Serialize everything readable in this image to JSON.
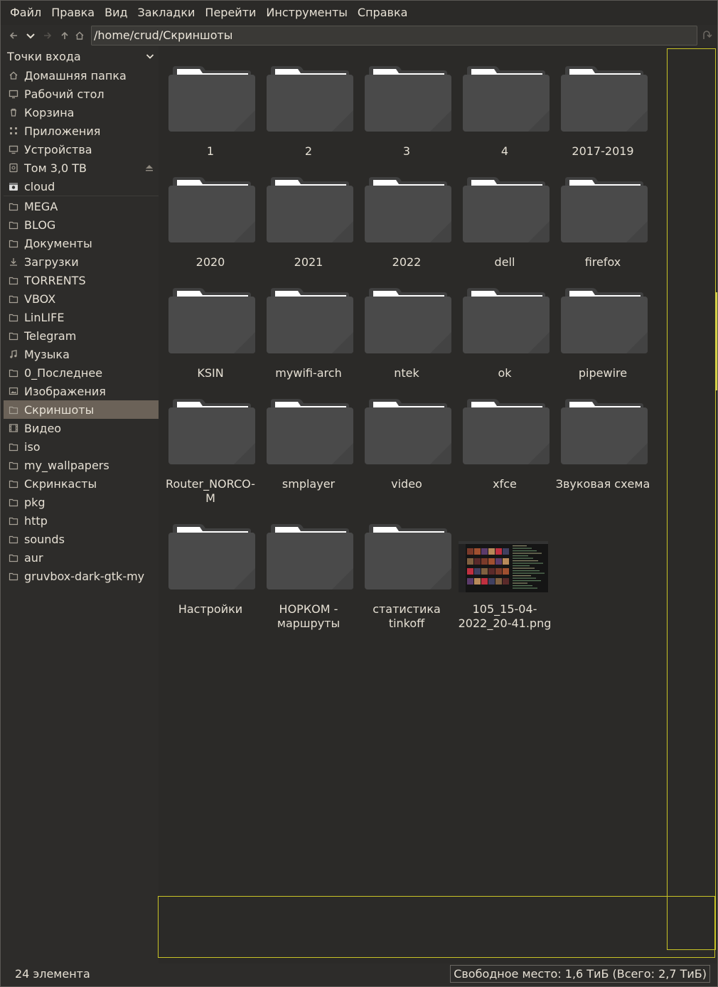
{
  "menu": [
    "Файл",
    "Правка",
    "Вид",
    "Закладки",
    "Перейти",
    "Инструменты",
    "Справка"
  ],
  "toolbar": {
    "path": "/home/crud/Скриншоты",
    "icons": [
      "back-icon",
      "dropdown-icon",
      "forward-icon",
      "up-icon",
      "home-icon",
      "reload-icon"
    ]
  },
  "sidebar": {
    "header": "Точки входа",
    "places": [
      {
        "label": "Домашняя папка",
        "icon": "home-icon"
      },
      {
        "label": "Рабочий стол",
        "icon": "desktop-icon"
      },
      {
        "label": "Корзина",
        "icon": "trash-icon"
      },
      {
        "label": "Приложения",
        "icon": "apps-icon"
      },
      {
        "label": "Устройства",
        "icon": "computer-icon"
      },
      {
        "label": "Том 3,0 ТВ",
        "icon": "drive-icon"
      },
      {
        "label": "cloud",
        "icon": "cloud-drive-icon"
      }
    ],
    "bookmarks": [
      {
        "label": "MEGA",
        "icon": "folder-icon"
      },
      {
        "label": "BLOG",
        "icon": "folder-icon"
      },
      {
        "label": "Документы",
        "icon": "folder-icon"
      },
      {
        "label": "Загрузки",
        "icon": "download-icon"
      },
      {
        "label": "TORRENTS",
        "icon": "folder-icon"
      },
      {
        "label": "VBOX",
        "icon": "folder-icon"
      },
      {
        "label": "LinLIFE",
        "icon": "folder-icon"
      },
      {
        "label": "Telegram",
        "icon": "folder-icon"
      },
      {
        "label": "Музыка",
        "icon": "music-icon"
      },
      {
        "label": "0_Последнее",
        "icon": "folder-icon"
      },
      {
        "label": "Изображения",
        "icon": "pictures-icon"
      },
      {
        "label": "Скриншоты",
        "icon": "folder-icon",
        "active": true
      },
      {
        "label": "Видео",
        "icon": "video-icon"
      },
      {
        "label": "iso",
        "icon": "folder-icon"
      },
      {
        "label": "my_wallpapers",
        "icon": "folder-icon"
      },
      {
        "label": "Скринкасты",
        "icon": "folder-icon"
      },
      {
        "label": "pkg",
        "icon": "folder-icon"
      },
      {
        "label": "http",
        "icon": "folder-icon"
      },
      {
        "label": "sounds",
        "icon": "folder-icon"
      },
      {
        "label": "aur",
        "icon": "folder-icon"
      },
      {
        "label": "gruvbox-dark-gtk-my",
        "icon": "folder-icon"
      }
    ]
  },
  "files": [
    {
      "name": "1",
      "type": "folder"
    },
    {
      "name": "2",
      "type": "folder"
    },
    {
      "name": "3",
      "type": "folder"
    },
    {
      "name": "4",
      "type": "folder"
    },
    {
      "name": "2017-2019",
      "type": "folder"
    },
    {
      "name": "2020",
      "type": "folder"
    },
    {
      "name": "2021",
      "type": "folder"
    },
    {
      "name": "2022",
      "type": "folder"
    },
    {
      "name": "dell",
      "type": "folder"
    },
    {
      "name": "firefox",
      "type": "folder"
    },
    {
      "name": "KSIN",
      "type": "folder"
    },
    {
      "name": "mywifi-arch",
      "type": "folder"
    },
    {
      "name": "ntek",
      "type": "folder"
    },
    {
      "name": "ok",
      "type": "folder"
    },
    {
      "name": "pipewire",
      "type": "folder"
    },
    {
      "name": "Router_NORCO-M",
      "type": "folder"
    },
    {
      "name": "smplayer",
      "type": "folder"
    },
    {
      "name": "video",
      "type": "folder"
    },
    {
      "name": "xfce",
      "type": "folder"
    },
    {
      "name": "Звуковая схема",
      "type": "folder"
    },
    {
      "name": "Настройки",
      "type": "folder"
    },
    {
      "name": "НОРКОМ - маршруты",
      "type": "folder"
    },
    {
      "name": "статистика tinkoff",
      "type": "folder"
    },
    {
      "name": "105_15-04-2022_20-41.png",
      "type": "image"
    }
  ],
  "status": {
    "count": "24 элемента",
    "free": "Свободное место: 1,6 ТиБ (Всего: 2,7 ТиБ)"
  },
  "colors": {
    "background": "#2b2a28",
    "folder": "#4a4947",
    "folder_tab": "#ffffff",
    "selection_highlight": "#6b6258",
    "rubberband": "#c9c427"
  }
}
